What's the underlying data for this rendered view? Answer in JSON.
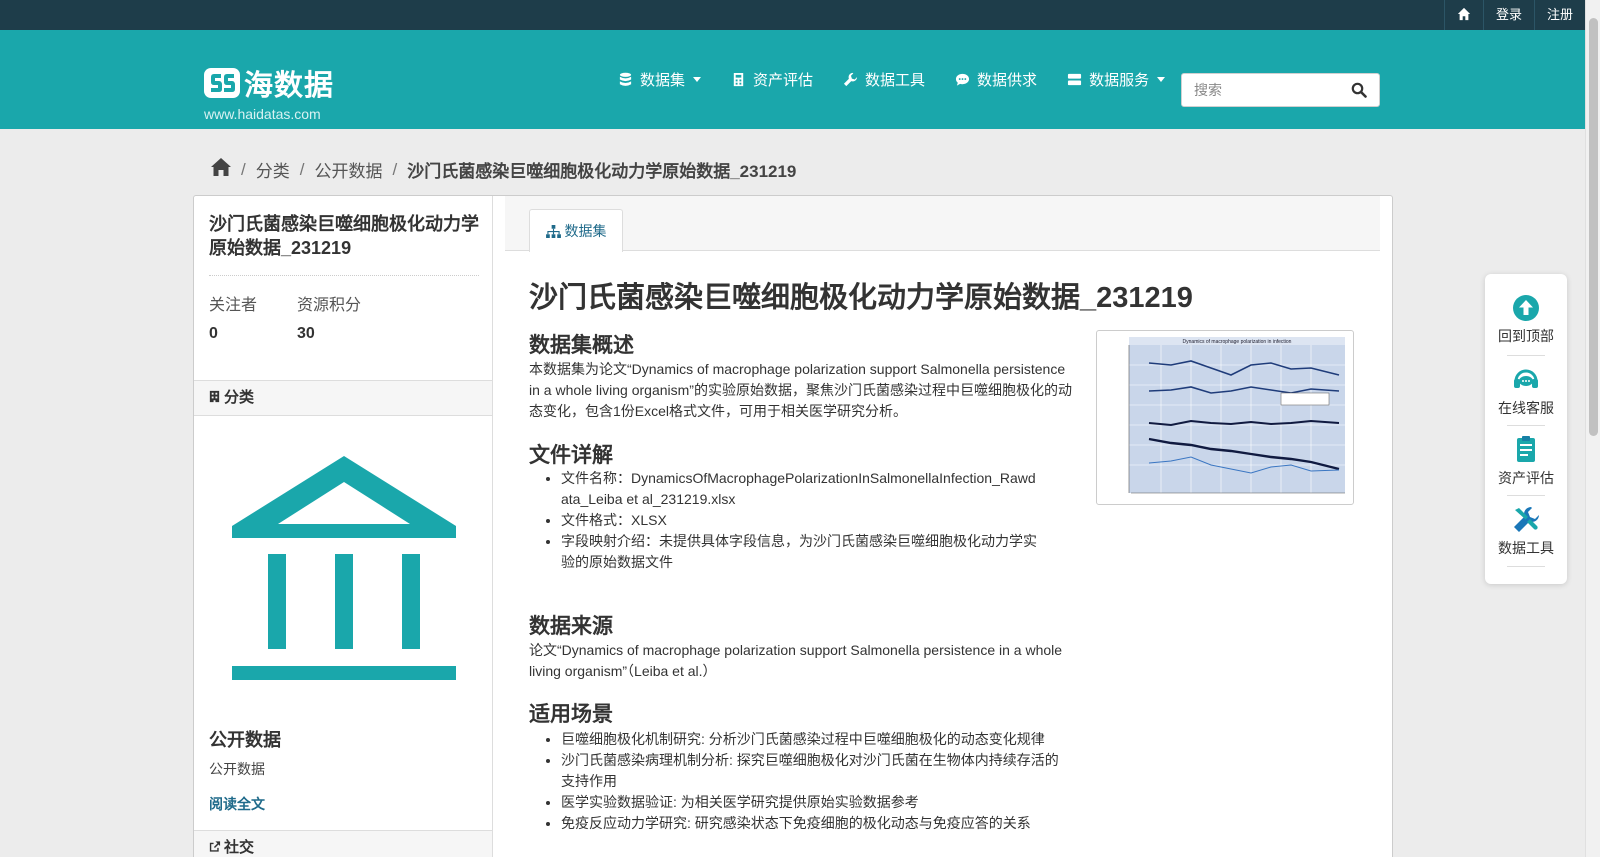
{
  "topbar": {
    "home_icon": "home-icon",
    "login": "登录",
    "register": "注册"
  },
  "brand": {
    "name": "海数据",
    "domain": "www.haidatas.com",
    "accent": "#1aa7ab"
  },
  "nav": {
    "items": [
      {
        "label": "数据集",
        "icon": "database-icon",
        "dropdown": true
      },
      {
        "label": "资产评估",
        "icon": "calculator-icon",
        "dropdown": false
      },
      {
        "label": "数据工具",
        "icon": "wrench-icon",
        "dropdown": false
      },
      {
        "label": "数据供求",
        "icon": "chat-icon",
        "dropdown": false
      },
      {
        "label": "数据服务",
        "icon": "server-icon",
        "dropdown": true
      }
    ]
  },
  "search": {
    "placeholder": "搜索",
    "value": ""
  },
  "breadcrumb": {
    "items": [
      "分类",
      "公开数据"
    ],
    "current": "沙门氏菌感染巨噬细胞极化动力学原始数据_231219"
  },
  "sidebar": {
    "title": "沙门氏菌感染巨噬细胞极化动力学原始数据_231219",
    "stats": [
      {
        "label": "关注者",
        "value": "0"
      },
      {
        "label": "资源积分",
        "value": "30"
      }
    ],
    "category_heading": "分类",
    "org_name": "公开数据",
    "org_desc": "公开数据",
    "read_more": "阅读全文",
    "social_heading": "社交"
  },
  "tabs": [
    {
      "label": "数据集",
      "active": true
    }
  ],
  "content": {
    "title": "沙门氏菌感染巨噬细胞极化动力学原始数据_231219",
    "overview_heading": "数据集概述",
    "overview_text": "本数据集为论文“Dynamics of macrophage polarization support Salmonella persistence in a whole living organism”的实验原始数据，聚焦沙门氏菌感染过程中巨噬细胞极化的动态变化，包含1份Excel格式文件，可用于相关医学研究分析。",
    "files_heading": "文件详解",
    "files": [
      "文件名称：DynamicsOfMacrophagePolarizationInSalmonellaInfection_Rawdata_Leiba et al_231219.xlsx",
      "文件格式：XLSX",
      "字段映射介绍：未提供具体字段信息，为沙门氏菌感染巨噬细胞极化动力学实验的原始数据文件"
    ],
    "source_heading": "数据来源",
    "source_text": "论文“Dynamics of macrophage polarization support Salmonella persistence in a whole living organism”（Leiba et al.）",
    "usage_heading": "适用场景",
    "usage": [
      "巨噬细胞极化机制研究: 分析沙门氏菌感染过程中巨噬细胞极化的动态变化规律",
      "沙门氏菌感染病理机制分析: 探究巨噬细胞极化对沙门氏菌在生物体内持续存活的支持作用",
      "医学实验数据验证: 为相关医学研究提供原始实验数据参考",
      "免疫反应动力学研究: 研究感染状态下免疫细胞的极化动态与免疫应答的关系"
    ],
    "thumbnail_caption": "Dynamics of macrophage polarization in infection"
  },
  "floatbar": {
    "items": [
      {
        "label": "回到顶部",
        "icon": "arrow-up-icon"
      },
      {
        "label": "在线客服",
        "icon": "headset-icon"
      },
      {
        "label": "资产评估",
        "icon": "document-icon"
      },
      {
        "label": "数据工具",
        "icon": "tools-icon"
      }
    ]
  }
}
